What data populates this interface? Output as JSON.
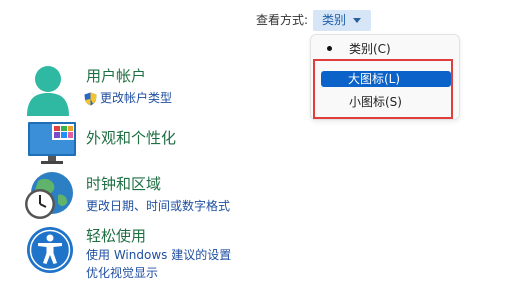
{
  "view_by": {
    "label": "查看方式:",
    "selected": "类别",
    "options": [
      "类别(C)",
      "大图标(L)",
      "小图标(S)"
    ]
  },
  "categories": [
    {
      "title": "用户帐户",
      "links": [
        "更改帐户类型"
      ]
    },
    {
      "title": "外观和个性化",
      "links": []
    },
    {
      "title": "时钟和区域",
      "links": [
        "更改日期、时间或数字格式"
      ]
    },
    {
      "title": "轻松使用",
      "links": [
        "使用 Windows 建议的设置",
        "优化视觉显示"
      ]
    }
  ],
  "colors": {
    "title_green": "#1f6f43",
    "link_blue": "#1f4fa0",
    "highlight": "#0b63c9",
    "annotation_red": "#e03d3d"
  },
  "icons": [
    "user-accounts-icon",
    "shield-icon",
    "appearance-icon",
    "clock-region-icon",
    "accessibility-icon"
  ]
}
